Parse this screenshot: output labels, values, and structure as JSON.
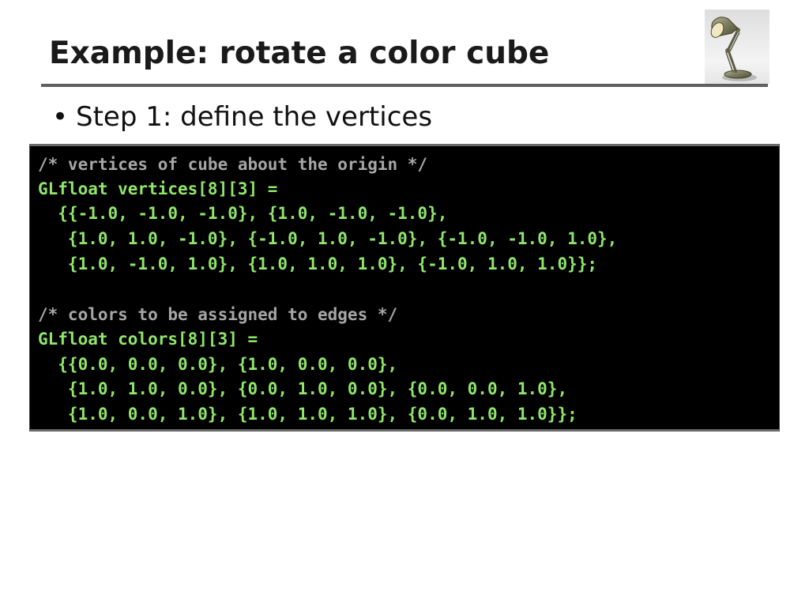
{
  "slide": {
    "title": "Example: rotate a color cube",
    "bullet_symbol": "•",
    "bullet_text": "Step 1: define the vertices",
    "logo_icon": "desk-lamp-icon"
  },
  "code": {
    "comment_color": "#a6a6a6",
    "code_color": "#8fe66a",
    "background": "#000000",
    "lines": [
      "/* vertices of cube about the origin */",
      "GLfloat vertices[8][3] =",
      "  {{-1.0, -1.0, -1.0}, {1.0, -1.0, -1.0},",
      "   {1.0, 1.0, -1.0}, {-1.0, 1.0, -1.0}, {-1.0, -1.0, 1.0},",
      "   {1.0, -1.0, 1.0}, {1.0, 1.0, 1.0}, {-1.0, 1.0, 1.0}};",
      "",
      "/* colors to be assigned to edges */",
      "GLfloat colors[8][3] =",
      "  {{0.0, 0.0, 0.0}, {1.0, 0.0, 0.0},",
      "   {1.0, 1.0, 0.0}, {0.0, 1.0, 0.0}, {0.0, 0.0, 1.0},",
      "   {1.0, 0.0, 1.0}, {1.0, 1.0, 1.0}, {0.0, 1.0, 1.0}};"
    ]
  }
}
